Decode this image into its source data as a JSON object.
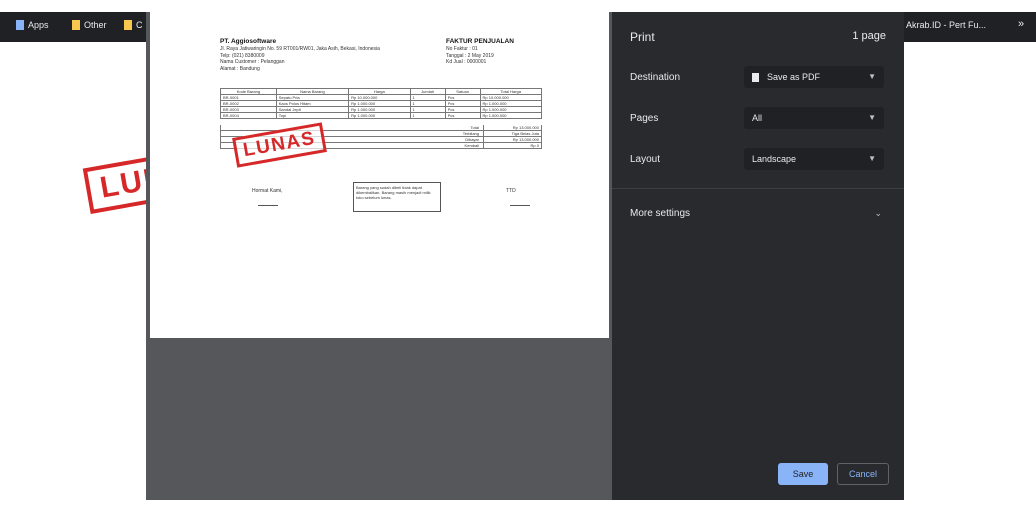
{
  "browser": {
    "bookmarks": [
      {
        "label": "Apps"
      },
      {
        "label": "Other"
      },
      {
        "label": "C"
      }
    ],
    "right_tab_text": "Akrab.ID - Pert Fu..."
  },
  "background_stamp": "LUN",
  "print": {
    "title": "Print",
    "page_count": "1 page",
    "destination_label": "Destination",
    "destination_value": "Save as PDF",
    "pages_label": "Pages",
    "pages_value": "All",
    "layout_label": "Layout",
    "layout_value": "Landscape",
    "more_settings_label": "More settings",
    "save_label": "Save",
    "cancel_label": "Cancel"
  },
  "invoice": {
    "company": "PT. Aggiosoftware",
    "address_lines": [
      "Jl. Raya Jatiwaringin No. 59 RT001/RW01, Jaka Asih, Bekasi, Indonesia",
      "Telp: (021) 8380009",
      "Nama Customer : Pelanggan",
      "Alamat : Bandung"
    ],
    "title": "FAKTUR PENJUALAN",
    "meta_lines": [
      "No Faktur : 01",
      "Tanggal : 2 May 2019",
      "Kd Jual : 0000001"
    ],
    "columns": [
      "Kode Barang",
      "Nama Barang",
      "Harga",
      "Jumlah",
      "Satuan",
      "Total Harga"
    ],
    "rows": [
      [
        "BR-0001",
        "Sepatu Pria",
        "Rp 10.000.000",
        "1",
        "Pcs",
        "Rp 10.000.000"
      ],
      [
        "BR-0002",
        "Kaos Polos Hitam",
        "Rp 1.000.000",
        "1",
        "Pcs",
        "Rp 1.000.000"
      ],
      [
        "BR-0003",
        "Sandal Jepit",
        "Rp 1.000.000",
        "1",
        "Pcs",
        "Rp 1.000.000"
      ],
      [
        "BR-0004",
        "Topi",
        "Rp 1.000.000",
        "1",
        "Pcs",
        "Rp 1.000.000"
      ]
    ],
    "summary": [
      {
        "label": "Total",
        "value": "Rp 13.000.000"
      },
      {
        "label": "Terbilang",
        "value": "Tiga Belas Juta"
      },
      {
        "label": "Dibayar",
        "value": "Rp 13.000.000"
      },
      {
        "label": "Kembali",
        "value": "Rp 0"
      }
    ],
    "stamp": "LUNAS",
    "sign_left": "Hormat Kami,",
    "sign_right": "TTD",
    "note": "Barang yang sudah dibeli tidak dapat dikembalikan. Barang masih menjadi milik toko sebelum lunas."
  }
}
